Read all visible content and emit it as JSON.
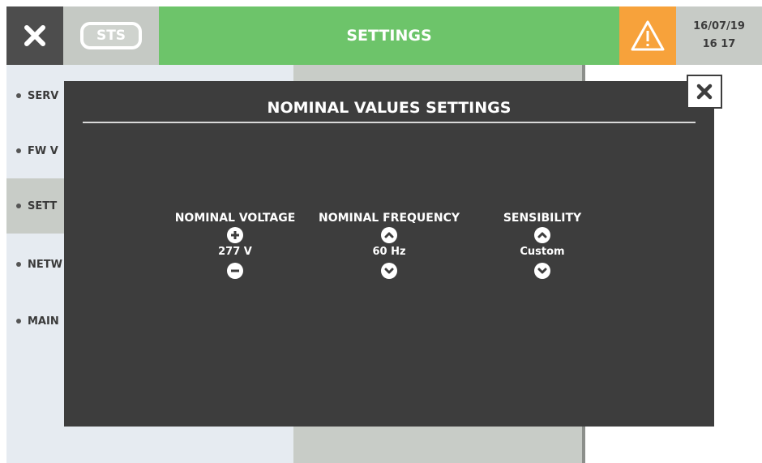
{
  "header": {
    "close_icon": "close-icon",
    "sts_label": "STS",
    "title": "SETTINGS",
    "warning_icon": "warning-triangle-icon",
    "date": "16/07/19",
    "time": "16 17",
    "colors": {
      "title_bar": "#6dc46a",
      "warning": "#f7a23b",
      "close_bg": "#4d4d4d"
    }
  },
  "sidebar": {
    "items": [
      {
        "label": "SERV"
      },
      {
        "label": "FW V"
      },
      {
        "label": "SETT"
      },
      {
        "label": "NETW"
      },
      {
        "label": "MAIN"
      }
    ],
    "active_index": 2
  },
  "modal": {
    "title": "NOMINAL VALUES SETTINGS",
    "close_icon": "close-icon",
    "settings": [
      {
        "label": "NOMINAL VOLTAGE",
        "value": "277 V",
        "up_icon": "plus-circle-icon",
        "down_icon": "minus-circle-icon"
      },
      {
        "label": "NOMINAL FREQUENCY",
        "value": "60 Hz",
        "up_icon": "chevron-up-circle-icon",
        "down_icon": "chevron-down-circle-icon"
      },
      {
        "label": "SENSIBILITY",
        "value": "Custom",
        "up_icon": "chevron-up-circle-icon",
        "down_icon": "chevron-down-circle-icon"
      }
    ]
  }
}
